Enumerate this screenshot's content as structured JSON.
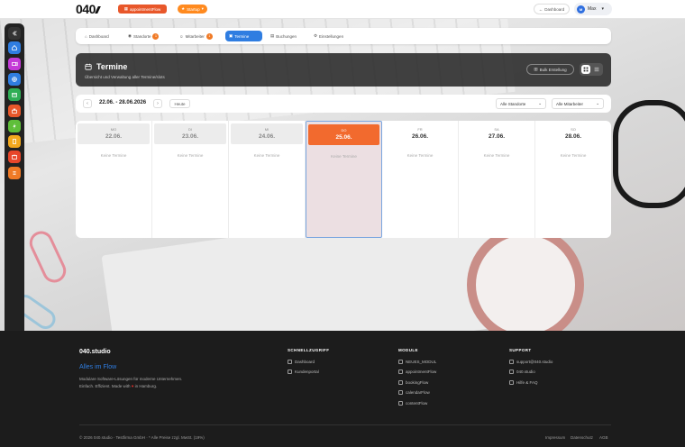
{
  "header": {
    "logo": "040",
    "app_pill": "appointmentFlow",
    "nav_pill": "Startup",
    "dashboard_button": "Dashboard",
    "user": {
      "initials": "M",
      "name": "Max"
    }
  },
  "tabs": [
    {
      "label": "Dashboard"
    },
    {
      "label": "Standorte",
      "count": "1"
    },
    {
      "label": "Mitarbeiter",
      "count": "1"
    },
    {
      "label": "Termine"
    },
    {
      "label": "Buchungen"
    },
    {
      "label": "Einstellungen"
    }
  ],
  "panel": {
    "title": "Termine",
    "subtitle": "Übersicht und Verwaltung aller Termine/slots",
    "bulk_button": "Bulk Erstellung"
  },
  "filters": {
    "date_range": "22.06. - 28.06.2026",
    "today_button": "Heute",
    "location_select": "Alle Standorte",
    "staff_select": "Alle Mitarbeiter"
  },
  "days": [
    {
      "name": "MO",
      "date": "22.06.",
      "empty": "Keine Termine"
    },
    {
      "name": "DI",
      "date": "23.06.",
      "empty": "Keine Termine"
    },
    {
      "name": "MI",
      "date": "24.06.",
      "empty": "Keine Termine"
    },
    {
      "name": "DO",
      "date": "25.06.",
      "empty": "Keine Termine"
    },
    {
      "name": "FR",
      "date": "26.06.",
      "empty": "Keine Termine"
    },
    {
      "name": "SA",
      "date": "27.06.",
      "empty": "Keine Termine"
    },
    {
      "name": "SO",
      "date": "28.06.",
      "empty": "Keine Termine"
    }
  ],
  "footer": {
    "brand": "040.studio",
    "tagline": "Alles im Flow",
    "desc_line1": "Modulare Software-Lösungen für moderne Unternehmen.",
    "desc_line2_a": "Einfach. Effizient. Made with",
    "desc_line2_b": "in Hamburg.",
    "quick_title": "SCHNELLZUGRIFF",
    "quick_links": [
      "Dashboard",
      "Kundenportal"
    ],
    "modules_title": "MODULE",
    "modules": [
      "NEUES_MODUL",
      "appointmentFlow",
      "bookingFlow",
      "calendarFlow",
      "contentFlow"
    ],
    "support_title": "SUPPORT",
    "support_links": [
      "support@040.studio",
      "040.studio",
      "Hilfe & FAQ"
    ],
    "copyright": "© 2026 040.studio · Testfirma GmbH · * Alle Preise zzgl. MwSt. (19%)",
    "legal": [
      "Impressum",
      "Datenschutz",
      "AGB"
    ]
  },
  "colors": {
    "accent_blue": "#2f7de1",
    "accent_orange": "#f26a2e",
    "rail_dark": "#222222",
    "footer_bg": "#1c1c1c"
  },
  "rail_icons": [
    "collapse-icon",
    "home-icon",
    "video-icon",
    "globe-icon",
    "calendar-icon",
    "briefcase-icon",
    "bolt-icon",
    "document-icon",
    "calendar-alt-icon",
    "list-icon",
    "help-icon",
    "plus-icon",
    "settings-icon"
  ]
}
